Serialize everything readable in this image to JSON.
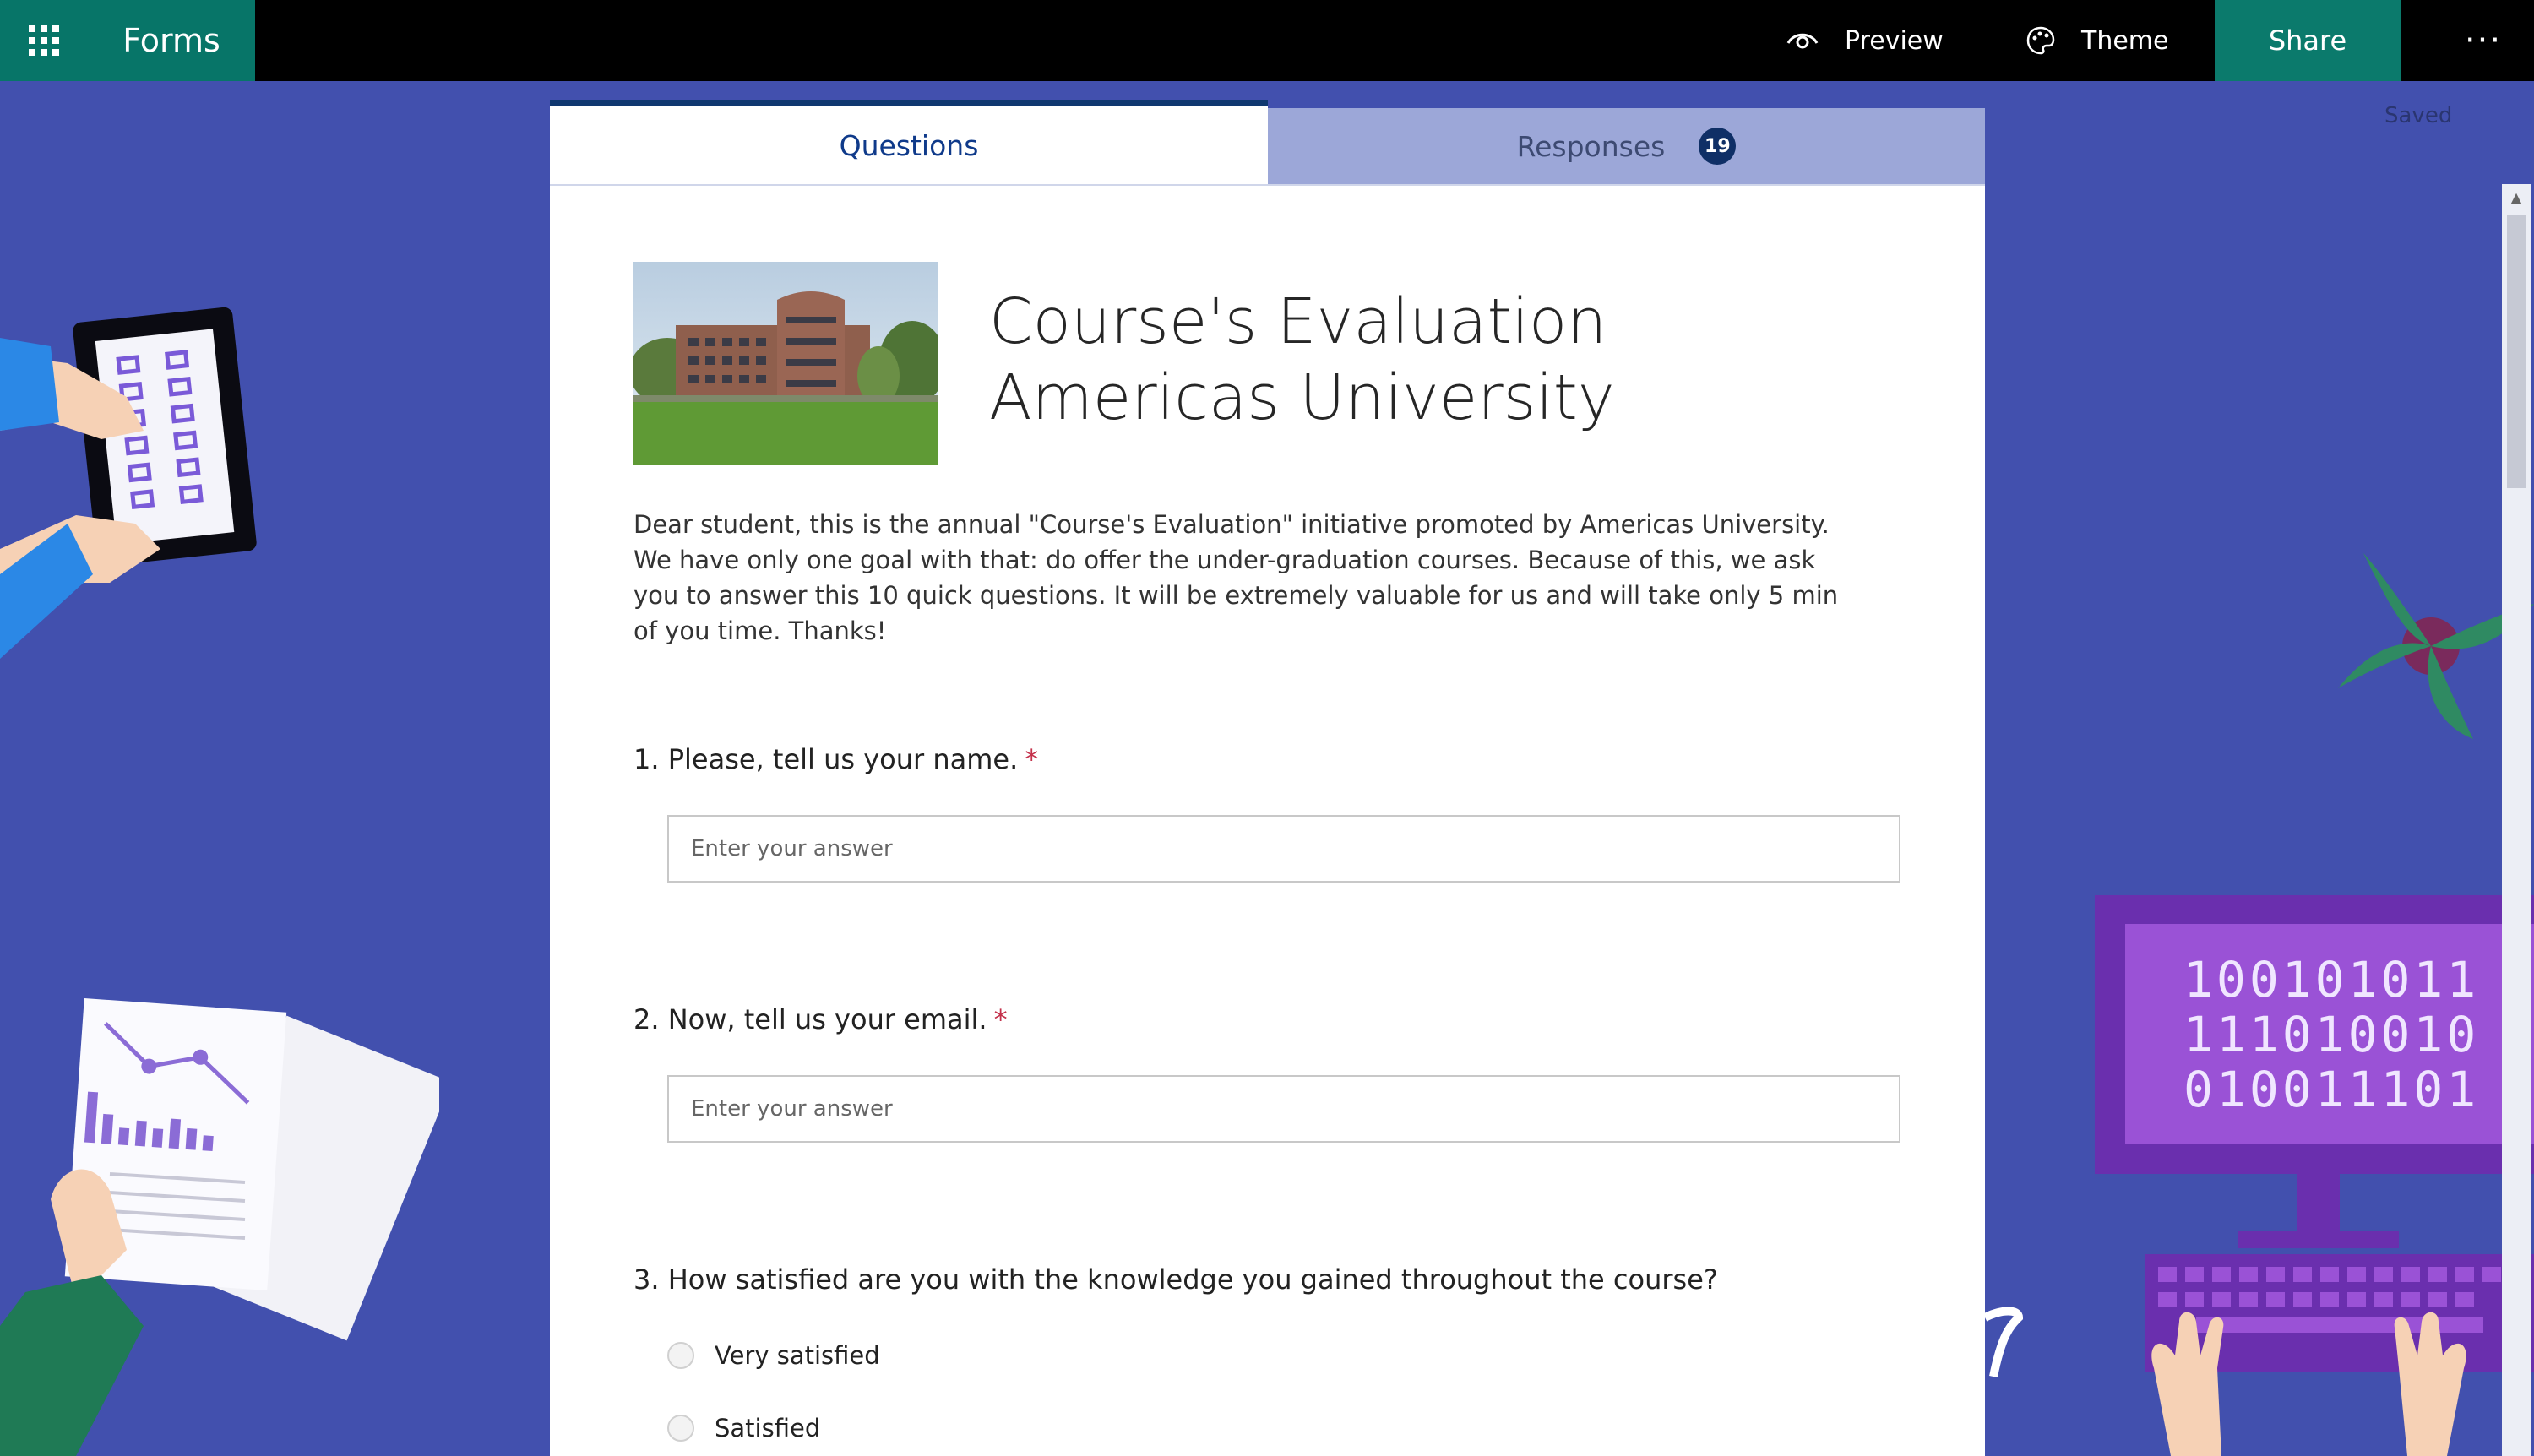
{
  "app": {
    "name": "Forms"
  },
  "toolbar": {
    "preview_label": "Preview",
    "theme_label": "Theme",
    "share_label": "Share",
    "more_label": "···"
  },
  "status": {
    "saved": "Saved"
  },
  "tabs": [
    {
      "label": "Questions",
      "selected": true
    },
    {
      "label": "Responses",
      "count": "19"
    }
  ],
  "form": {
    "title_line1": "Course's Evaluation",
    "title_line2": "Americas University",
    "description": "Dear student, this is the annual \"Course's Evaluation\" initiative promoted by Americas University. We have only one goal with that: do offer the under-graduation courses. Because of this, we ask you to answer this 10 quick questions. It will be extremely valuable for us and will take only 5 min of you time. Thanks!",
    "questions": [
      {
        "text": "1. Please, tell us your name.",
        "required": "*",
        "placeholder": "Enter your answer"
      },
      {
        "text": "2. Now, tell us your email.",
        "required": "*",
        "placeholder": "Enter your answer"
      },
      {
        "text": "3. How satisfied are you with the knowledge you gained throughout the course?",
        "options": [
          "Very satisfied",
          "Satisfied"
        ]
      }
    ]
  },
  "decor": {
    "binary_lines": [
      "100101011",
      "111010010",
      "010011101"
    ]
  },
  "colors": {
    "topbar": "#000000",
    "brand": "#077568",
    "share": "#0b7a6c",
    "background": "#4250ae",
    "required": "#c4314b"
  }
}
